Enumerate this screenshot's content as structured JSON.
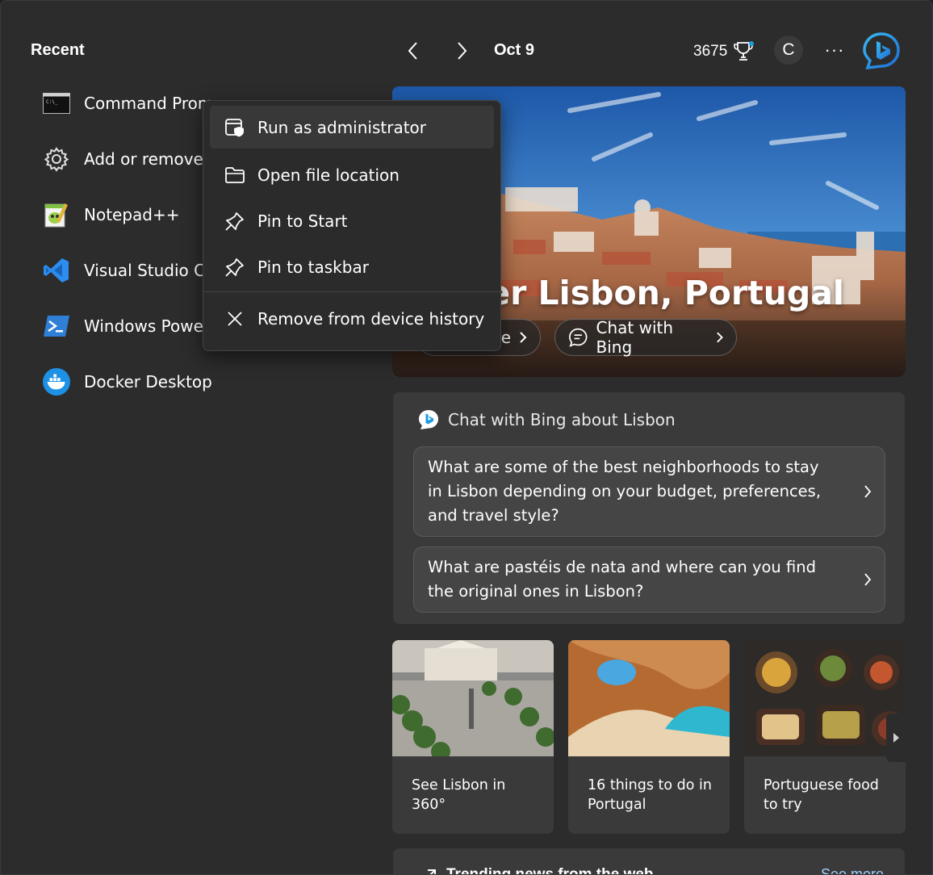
{
  "recent": {
    "title": "Recent",
    "items": [
      {
        "label": "Command Prom",
        "icon": "command-prompt-icon"
      },
      {
        "label": "Add or remove",
        "icon": "gear-icon"
      },
      {
        "label": "Notepad++",
        "icon": "notepadpp-icon"
      },
      {
        "label": "Visual Studio Co",
        "icon": "vscode-icon"
      },
      {
        "label": "Windows Power",
        "icon": "powershell-icon"
      },
      {
        "label": "Docker Desktop",
        "icon": "docker-icon"
      }
    ]
  },
  "topbar": {
    "date": "Oct 9",
    "points": "3675",
    "avatar_initial": "C",
    "more": "···"
  },
  "hero": {
    "title": "ver Lisbon, Portugal",
    "left_pill": "re",
    "chat_pill": "Chat with Bing"
  },
  "chat": {
    "heading": "Chat with Bing about Lisbon",
    "questions": [
      "What are some of the best neighborhoods to stay in Lisbon depending on your budget, preferences, and travel style?",
      "What are pastéis de nata and where can you find the original ones in Lisbon?"
    ]
  },
  "tiles": [
    {
      "label": "See Lisbon in 360°"
    },
    {
      "label": "16 things to do in Portugal"
    },
    {
      "label": "Portuguese food to try"
    }
  ],
  "trending": {
    "title": "Trending news from the web",
    "more": "See more"
  },
  "context_menu": {
    "items": [
      {
        "label": "Run as administrator",
        "icon": "shield-app-icon"
      },
      {
        "label": "Open file location",
        "icon": "folder-icon"
      },
      {
        "label": "Pin to Start",
        "icon": "pin-icon"
      },
      {
        "label": "Pin to taskbar",
        "icon": "pin-icon"
      },
      {
        "label": "Remove from device history",
        "icon": "close-icon"
      }
    ]
  },
  "colors": {
    "background": "#2c2c2c",
    "card": "#3a3a3a",
    "bing_blue": "#1b9de2",
    "vscode_blue": "#2d8cf0"
  }
}
